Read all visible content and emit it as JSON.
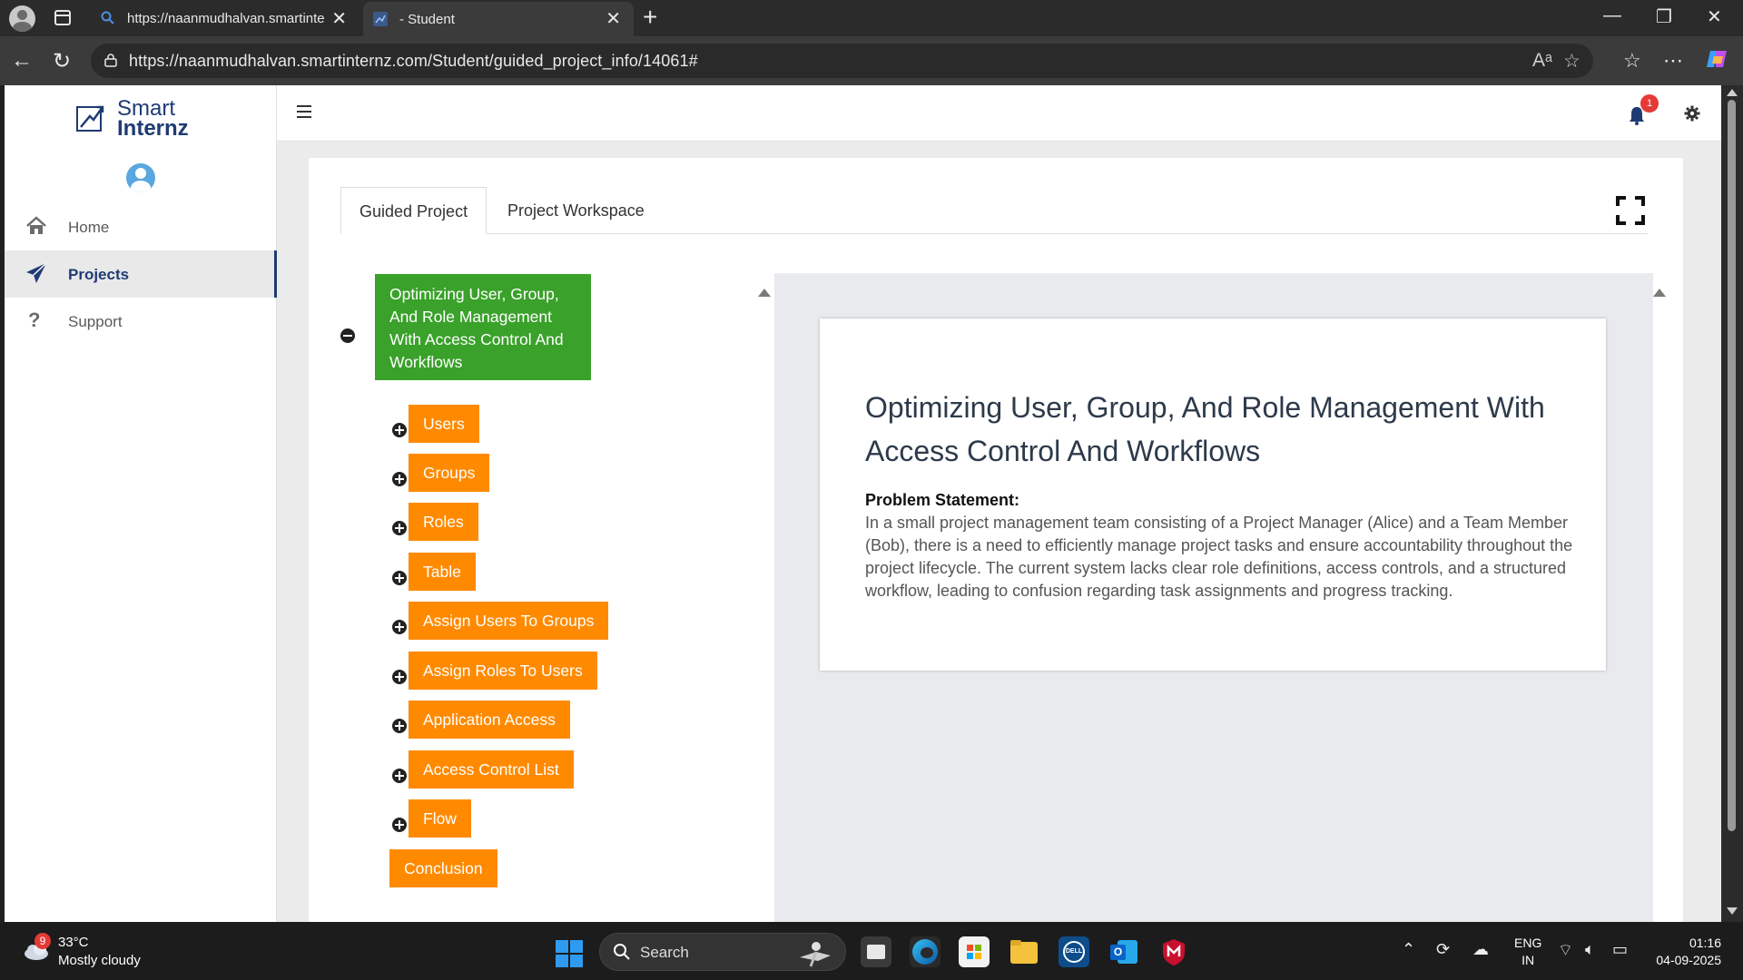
{
  "browser": {
    "tabs": [
      {
        "label": "https://naanmudhalvan.smartinte"
      },
      {
        "label": "- Student"
      }
    ],
    "url": "https://naanmudhalvan.smartinternz.com/Student/guided_project_info/14061#"
  },
  "sidebar": {
    "logo_line1": "Smart",
    "logo_line2": "Internz",
    "items": [
      {
        "label": "Home"
      },
      {
        "label": "Projects"
      },
      {
        "label": "Support"
      }
    ]
  },
  "topbar": {
    "notification_count": "1"
  },
  "project": {
    "tabs": [
      {
        "label": "Guided Project"
      },
      {
        "label": "Project Workspace"
      }
    ],
    "tree": {
      "root": "Optimizing User, Group, And Role Management With Access Control And Workflows",
      "children": [
        {
          "label": "Users"
        },
        {
          "label": "Groups"
        },
        {
          "label": "Roles"
        },
        {
          "label": "Table"
        },
        {
          "label": "Assign Users To Groups"
        },
        {
          "label": "Assign Roles To Users"
        },
        {
          "label": "Application Access"
        },
        {
          "label": "Access Control List"
        },
        {
          "label": "Flow"
        },
        {
          "label": "Conclusion"
        }
      ]
    },
    "content": {
      "title": "Optimizing User, Group, And Role Management With Access Control And Workflows",
      "problem_label": "Problem Statement:",
      "problem_text": "In a small project management team consisting of a Project Manager (Alice) and a Team Member (Bob), there is a need to efficiently manage project tasks and ensure accountability throughout the project lifecycle. The current system lacks clear role definitions, access controls, and a structured workflow, leading to confusion regarding task assignments and progress tracking."
    }
  },
  "taskbar": {
    "weather_badge": "9",
    "temperature": "33°C",
    "weather": "Mostly cloudy",
    "search_label": "Search",
    "lang1": "ENG",
    "lang2": "IN",
    "time": "01:16",
    "date": "04-09-2025"
  },
  "colors": {
    "root_node": "#3aa12a",
    "child_node": "#ff8a00",
    "brand": "#1f3b73"
  }
}
